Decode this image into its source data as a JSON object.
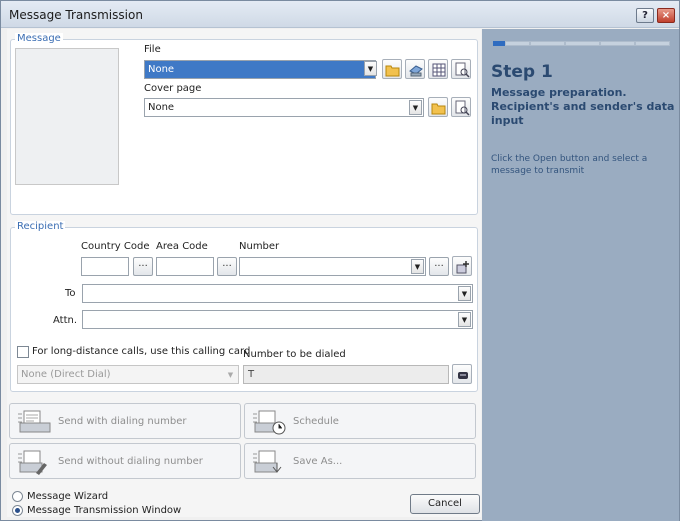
{
  "window": {
    "title": "Message Transmission",
    "help": "?",
    "close": "×"
  },
  "message": {
    "legend": "Message",
    "file_label": "File",
    "file_value": "None",
    "cover_label": "Cover page",
    "cover_value": "None"
  },
  "recipient": {
    "legend": "Recipient",
    "country_code_label": "Country Code",
    "area_code_label": "Area Code",
    "number_label": "Number",
    "to_label": "To",
    "attn_label": "Attn.",
    "long_distance_label": "For long-distance calls, use this calling card",
    "calling_card_value": "None (Direct Dial)",
    "number_to_dial_label": "Number to be dialed",
    "number_to_dial_value": "T",
    "dots": "..."
  },
  "actions": {
    "send_with": "Send with dialing number",
    "schedule": "Schedule",
    "send_without": "Send without dialing number",
    "save_as": "Save As..."
  },
  "mode": {
    "wizard": "Message Wizard",
    "window": "Message Transmission Window",
    "selected": "window"
  },
  "cancel_label": "Cancel",
  "wizard_panel": {
    "step": "Step 1",
    "description": "Message preparation. Recipient's and sender's data input",
    "hint": "Click the Open button and select a message to transmit",
    "steps_total": 5,
    "current_step": 1
  },
  "colors": {
    "accent": "#3f79c6",
    "panel": "#9aacc1",
    "title_text": "#2b4a71"
  }
}
